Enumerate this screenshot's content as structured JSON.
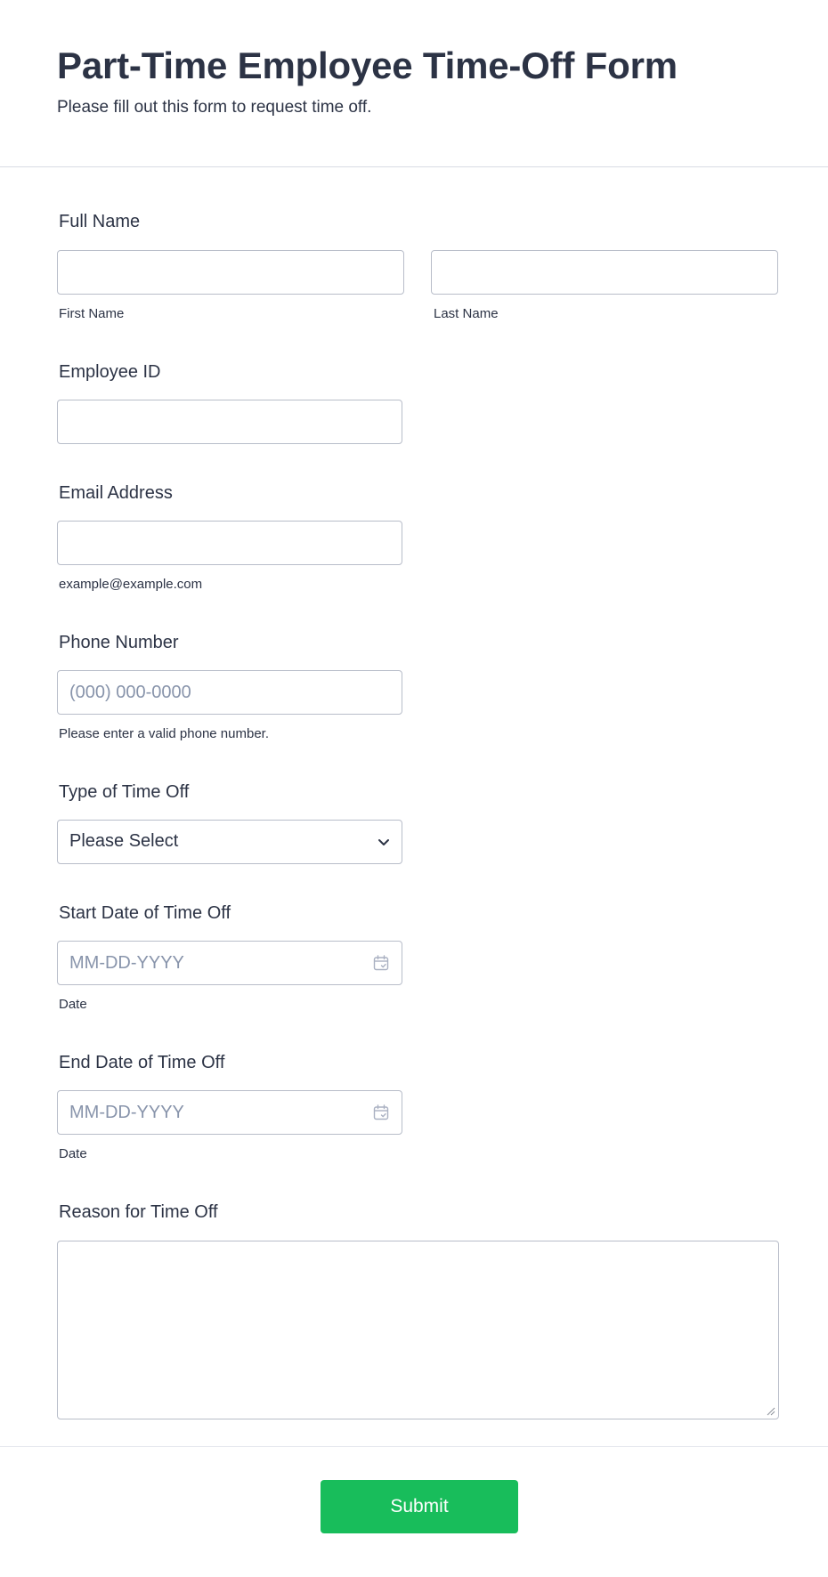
{
  "header": {
    "title": "Part-Time Employee Time-Off Form",
    "subtitle": "Please fill out this form to request time off."
  },
  "fields": {
    "full_name": {
      "label": "Full Name",
      "first_value": "",
      "last_value": "",
      "first_sublabel": "First Name",
      "last_sublabel": "Last Name"
    },
    "employee_id": {
      "label": "Employee ID",
      "value": ""
    },
    "email": {
      "label": "Email Address",
      "value": "",
      "sublabel": "example@example.com"
    },
    "phone": {
      "label": "Phone Number",
      "value": "",
      "placeholder": "(000) 000-0000",
      "sublabel": "Please enter a valid phone number."
    },
    "time_off_type": {
      "label": "Type of Time Off",
      "selected": "Please Select"
    },
    "start_date": {
      "label": "Start Date of Time Off",
      "value": "",
      "placeholder": "MM-DD-YYYY",
      "sublabel": "Date"
    },
    "end_date": {
      "label": "End Date of Time Off",
      "value": "",
      "placeholder": "MM-DD-YYYY",
      "sublabel": "Date"
    },
    "reason": {
      "label": "Reason for Time Off",
      "value": ""
    }
  },
  "actions": {
    "submit_label": "Submit"
  },
  "icons": {
    "select": "chevron-down-icon",
    "date": "calendar-icon",
    "textarea": "resize-grip-icon"
  },
  "colors": {
    "text": "#2c3345",
    "placeholder": "#8894ab",
    "border": "#b8bdc9",
    "submit": "#18bd5b"
  }
}
